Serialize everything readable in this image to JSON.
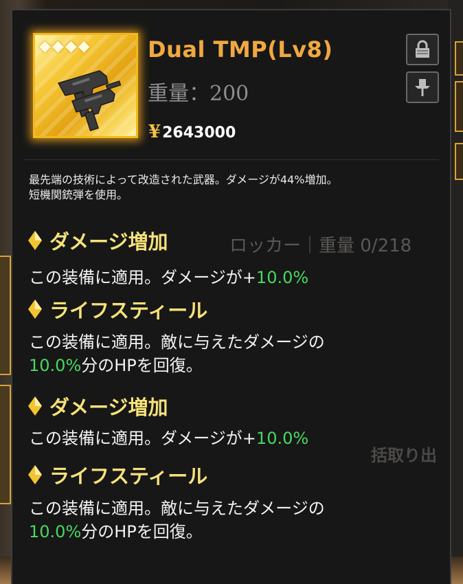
{
  "item": {
    "name": "Dual TMP(Lv8)",
    "weight_label": "重量：",
    "weight_value": "200",
    "currency_symbol": "¥",
    "price": "2643000",
    "rarity_stars": 4,
    "icon": "submachine-gun-icon",
    "description_line1": "最先端の技術によって改造された武器。ダメージが44%増加。",
    "description_line2": "短機関銃弾を使用。"
  },
  "buttons": {
    "lock_icon": "lock-icon",
    "pin_icon": "pin-icon"
  },
  "skills": [
    {
      "name": "ダメージ増加",
      "text_a": "この装備に適用。ダメージが+",
      "value": "10.0%",
      "text_b": ""
    },
    {
      "name": "ライフスティール",
      "text_a": "この装備に適用。敵に与えたダメージの",
      "value": "10.0%",
      "text_b": "分のHPを回復。"
    },
    {
      "name": "ダメージ増加",
      "text_a": "この装備に適用。ダメージが+",
      "value": "10.0%",
      "text_b": ""
    },
    {
      "name": "ライフスティール",
      "text_a": "この装備に適用。敵に与えたダメージの",
      "value": "10.0%",
      "text_b": "分のHPを回復。"
    }
  ],
  "background": {
    "locker_text": "ロッカー｜重量 0/218",
    "button_text": "括取り出"
  },
  "colors": {
    "title": "#f0a840",
    "skill_name": "#f6e27a",
    "value_green": "#48d860",
    "gold_frame": "#f4b91a"
  }
}
